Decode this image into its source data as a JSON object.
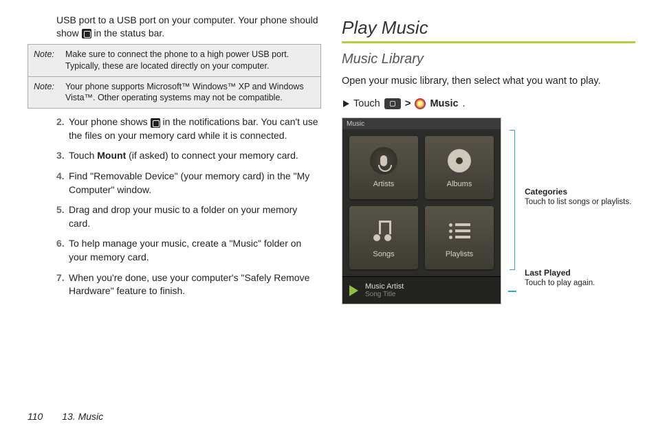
{
  "leftColumn": {
    "topPara": "USB port to a USB port on your computer. Your phone should show",
    "topParaAfterIcon": " in the status bar.",
    "note1_label": "Note:",
    "note1_text": "Make sure to connect the phone to a high power USB port. Typically, these are located directly on your computer.",
    "note2_label": "Note:",
    "note2_text": "Your phone supports Microsoft™ Windows™ XP and Windows Vista™. Other operating systems may not be compatible.",
    "steps": [
      {
        "num": "2.",
        "before": "Your phone shows ",
        "after": " in the notifications bar. You can't use the files on your memory card while it is connected."
      },
      {
        "num": "3.",
        "before": "Touch ",
        "bold": "Mount",
        "after": " (if asked) to connect your memory card."
      },
      {
        "num": "4.",
        "text": "Find \"Removable Device\" (your memory card) in the \"My Computer\" window."
      },
      {
        "num": "5.",
        "text": "Drag and drop your music to a folder on your memory card."
      },
      {
        "num": "6.",
        "text": "To help manage your music, create a \"Music\" folder on your memory card."
      },
      {
        "num": "7.",
        "text": "When you're done, use your computer's \"Safely Remove Hardware\" feature to finish."
      }
    ]
  },
  "rightColumn": {
    "heading": "Play Music",
    "subheading": "Music Library",
    "intro": "Open your music library, then select what you want to play.",
    "touch_word": "Touch",
    "caret": ">",
    "music_label": "Music",
    "period": ".",
    "phone": {
      "title": "Music",
      "tiles": [
        "Artists",
        "Albums",
        "Songs",
        "Playlists"
      ],
      "last_played": {
        "artist": "Music Artist",
        "song": "Song Title"
      }
    },
    "callouts": {
      "categories": {
        "title": "Categories",
        "text": "Touch to list songs or playlists."
      },
      "last": {
        "title": "Last Played",
        "text": "Touch to play again."
      }
    }
  },
  "footer": {
    "page": "110",
    "section": "13. Music"
  }
}
